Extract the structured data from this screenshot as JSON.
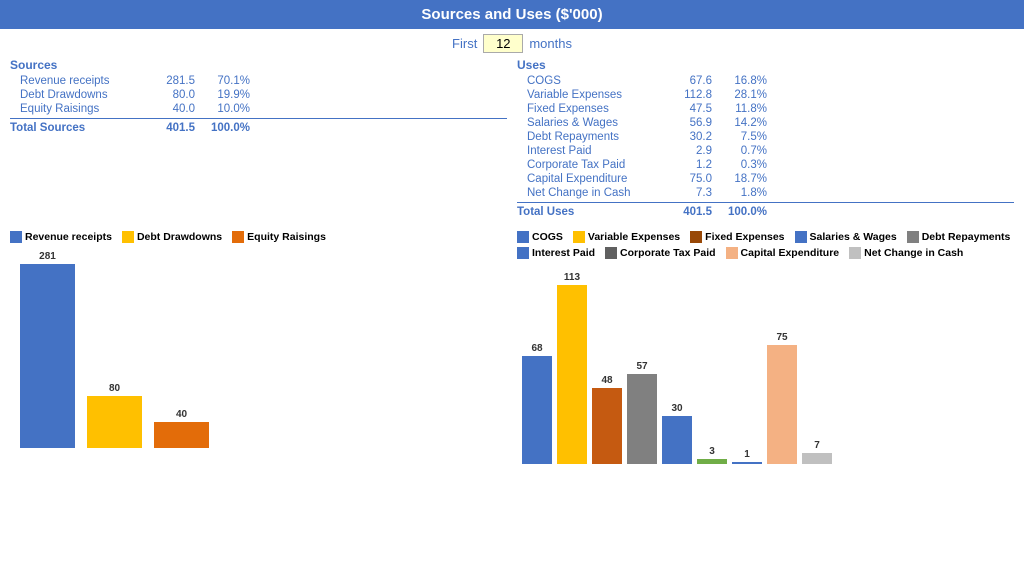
{
  "header": {
    "title": "Sources and Uses ($'000)"
  },
  "months_row": {
    "first_label": "First",
    "value": "12",
    "months_label": "months"
  },
  "sources": {
    "section_label": "Sources",
    "items": [
      {
        "label": "Revenue receipts",
        "value": "281.5",
        "pct": "70.1%"
      },
      {
        "label": "Debt Drawdowns",
        "value": "80.0",
        "pct": "19.9%"
      },
      {
        "label": "Equity Raisings",
        "value": "40.0",
        "pct": "10.0%"
      }
    ],
    "total_label": "Total Sources",
    "total_value": "401.5",
    "total_pct": "100.0%"
  },
  "uses": {
    "section_label": "Uses",
    "items": [
      {
        "label": "COGS",
        "value": "67.6",
        "pct": "16.8%"
      },
      {
        "label": "Variable Expenses",
        "value": "112.8",
        "pct": "28.1%"
      },
      {
        "label": "Fixed Expenses",
        "value": "47.5",
        "pct": "11.8%"
      },
      {
        "label": "Salaries & Wages",
        "value": "56.9",
        "pct": "14.2%"
      },
      {
        "label": "Debt Repayments",
        "value": "30.2",
        "pct": "7.5%"
      },
      {
        "label": "Interest Paid",
        "value": "2.9",
        "pct": "0.7%"
      },
      {
        "label": "Corporate Tax Paid",
        "value": "1.2",
        "pct": "0.3%"
      },
      {
        "label": "Capital Expenditure",
        "value": "75.0",
        "pct": "18.7%"
      },
      {
        "label": "Net Change in Cash",
        "value": "7.3",
        "pct": "1.8%"
      }
    ],
    "total_label": "Total Uses",
    "total_value": "401.5",
    "total_pct": "100.0%"
  },
  "chart_left": {
    "legend": [
      {
        "label": "Revenue receipts",
        "color": "#4472C4"
      },
      {
        "label": "Debt Drawdowns",
        "color": "#FFC000"
      },
      {
        "label": "Equity Raisings",
        "color": "#E36C09"
      }
    ],
    "bars": [
      {
        "label": "281",
        "value": 281,
        "color": "#4472C4"
      },
      {
        "label": "80",
        "value": 80,
        "color": "#FFC000"
      },
      {
        "label": "40",
        "value": 40,
        "color": "#E36C09"
      }
    ]
  },
  "chart_right": {
    "legend": [
      {
        "label": "COGS",
        "color": "#4472C4"
      },
      {
        "label": "Variable Expenses",
        "color": "#FFC000"
      },
      {
        "label": "Fixed Expenses",
        "color": "#984807"
      },
      {
        "label": "Salaries & Wages",
        "color": "#4472C4"
      },
      {
        "label": "Debt Repayments",
        "color": "#A5A5A5"
      },
      {
        "label": "Interest Paid",
        "color": "#4472C4"
      },
      {
        "label": "Corporate Tax Paid",
        "color": "#808080"
      },
      {
        "label": "Capital Expenditure",
        "color": "#F4CCAC"
      },
      {
        "label": "Net Change in Cash",
        "color": "#C0C0C0"
      }
    ],
    "bars": [
      {
        "label": "68",
        "value": 68,
        "color": "#4472C4"
      },
      {
        "label": "113",
        "value": 113,
        "color": "#FFC000"
      },
      {
        "label": "48",
        "value": 48,
        "color": "#C55A11"
      },
      {
        "label": "57",
        "value": 57,
        "color": "#808080"
      },
      {
        "label": "30",
        "value": 30,
        "color": "#4472C4"
      },
      {
        "label": "3",
        "value": 3,
        "color": "#70AD47"
      },
      {
        "label": "1",
        "value": 1,
        "color": "#4472C4"
      },
      {
        "label": "75",
        "value": 75,
        "color": "#F4B183"
      },
      {
        "label": "7",
        "value": 7,
        "color": "#C0C0C0"
      }
    ]
  },
  "colors": {
    "accent": "#4472C4",
    "header_bg": "#4472C4",
    "header_text": "#ffffff"
  }
}
